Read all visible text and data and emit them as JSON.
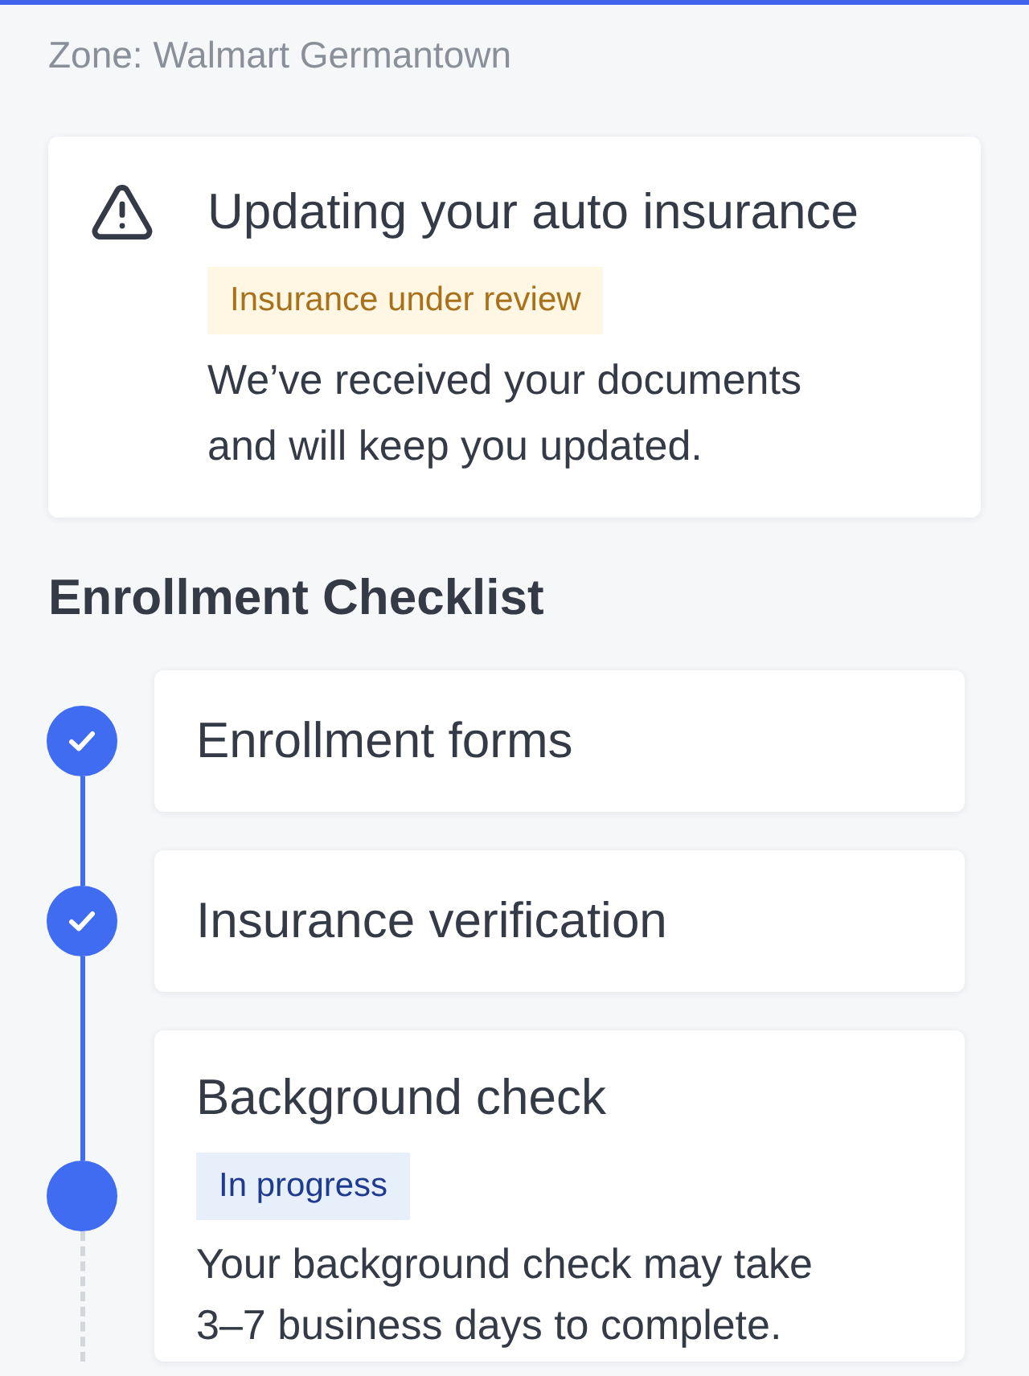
{
  "header": {
    "zone": "Zone: Walmart Germantown"
  },
  "alert": {
    "kind": "warning",
    "title": "Updating your auto insurance",
    "badge": {
      "label": "Insurance under review",
      "kind": "warning"
    },
    "message": "We’ve received your documents and will keep you updated."
  },
  "checklist": {
    "title": "Enrollment Checklist",
    "steps": [
      {
        "title": "Enrollment forms",
        "done": true
      },
      {
        "title": "Insurance verification",
        "done": true
      },
      {
        "title": "Background check",
        "done": false,
        "badge": {
          "label": "In progress",
          "kind": "info"
        },
        "description": "Your background check may take 3–7 business days to complete."
      }
    ]
  }
}
